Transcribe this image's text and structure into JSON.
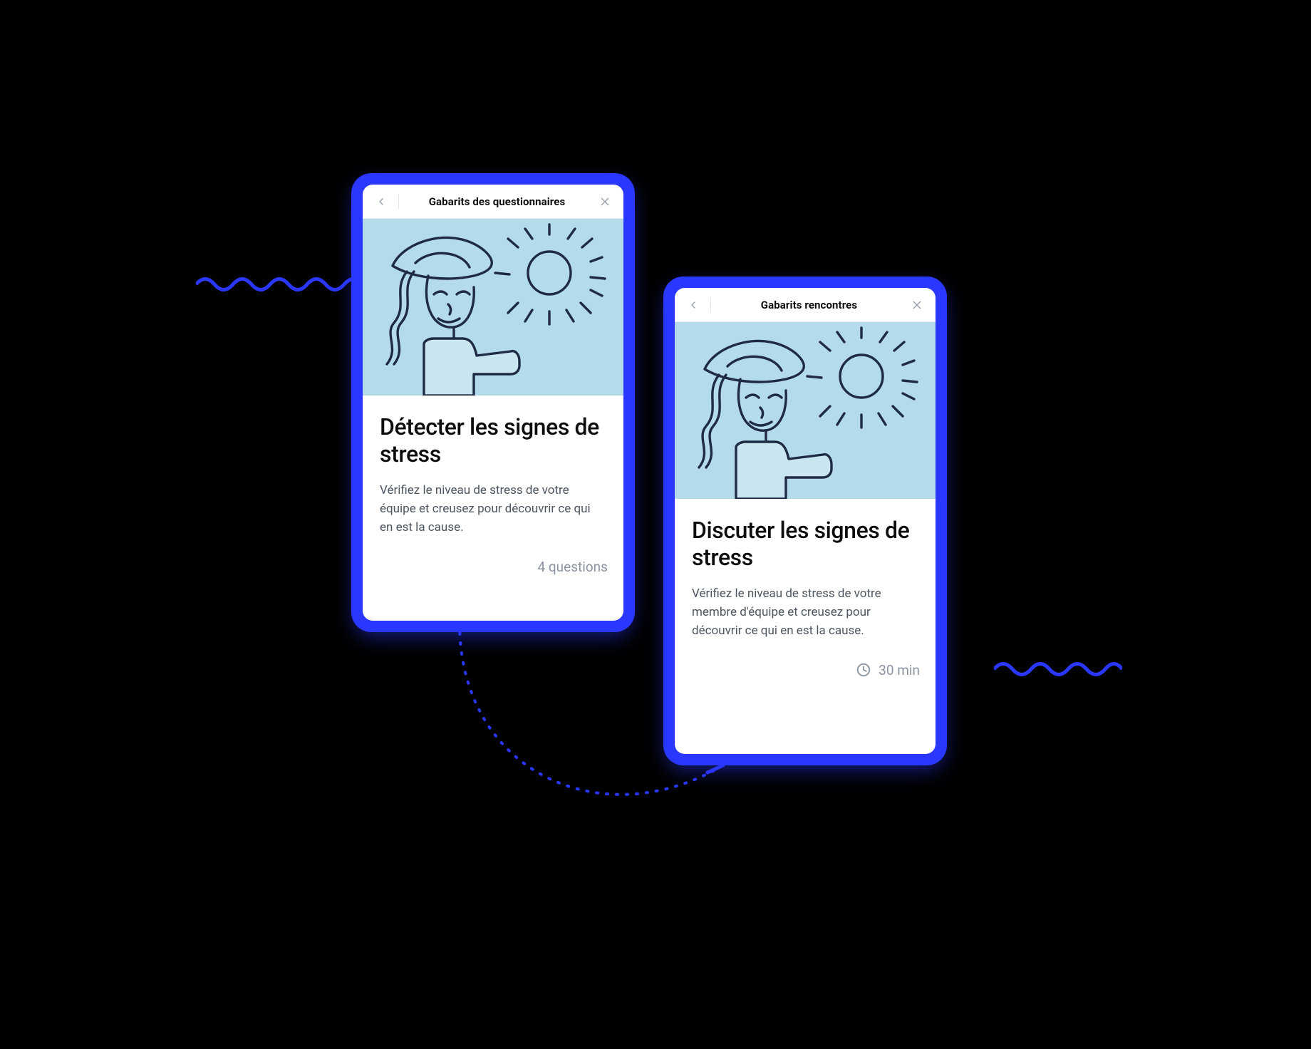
{
  "colors": {
    "accent": "#2a38ff",
    "illus_bg": "#b3dbea",
    "illus_stroke": "#1f2a44"
  },
  "cards": {
    "left": {
      "header_title": "Gabarits des questionnaires",
      "title": "Détecter les signes de stress",
      "desc": "Vérifiez le niveau de stress de votre équipe et creusez pour découvrir ce qui en est la cause.",
      "footer_label": "4 questions"
    },
    "right": {
      "header_title": "Gabarits rencontres",
      "title": "Discuter les signes de stress",
      "desc": "Vérifiez le niveau de stress de votre membre d'équipe et creusez pour découvrir ce qui en est la cause.",
      "footer_label": "30 min"
    }
  }
}
